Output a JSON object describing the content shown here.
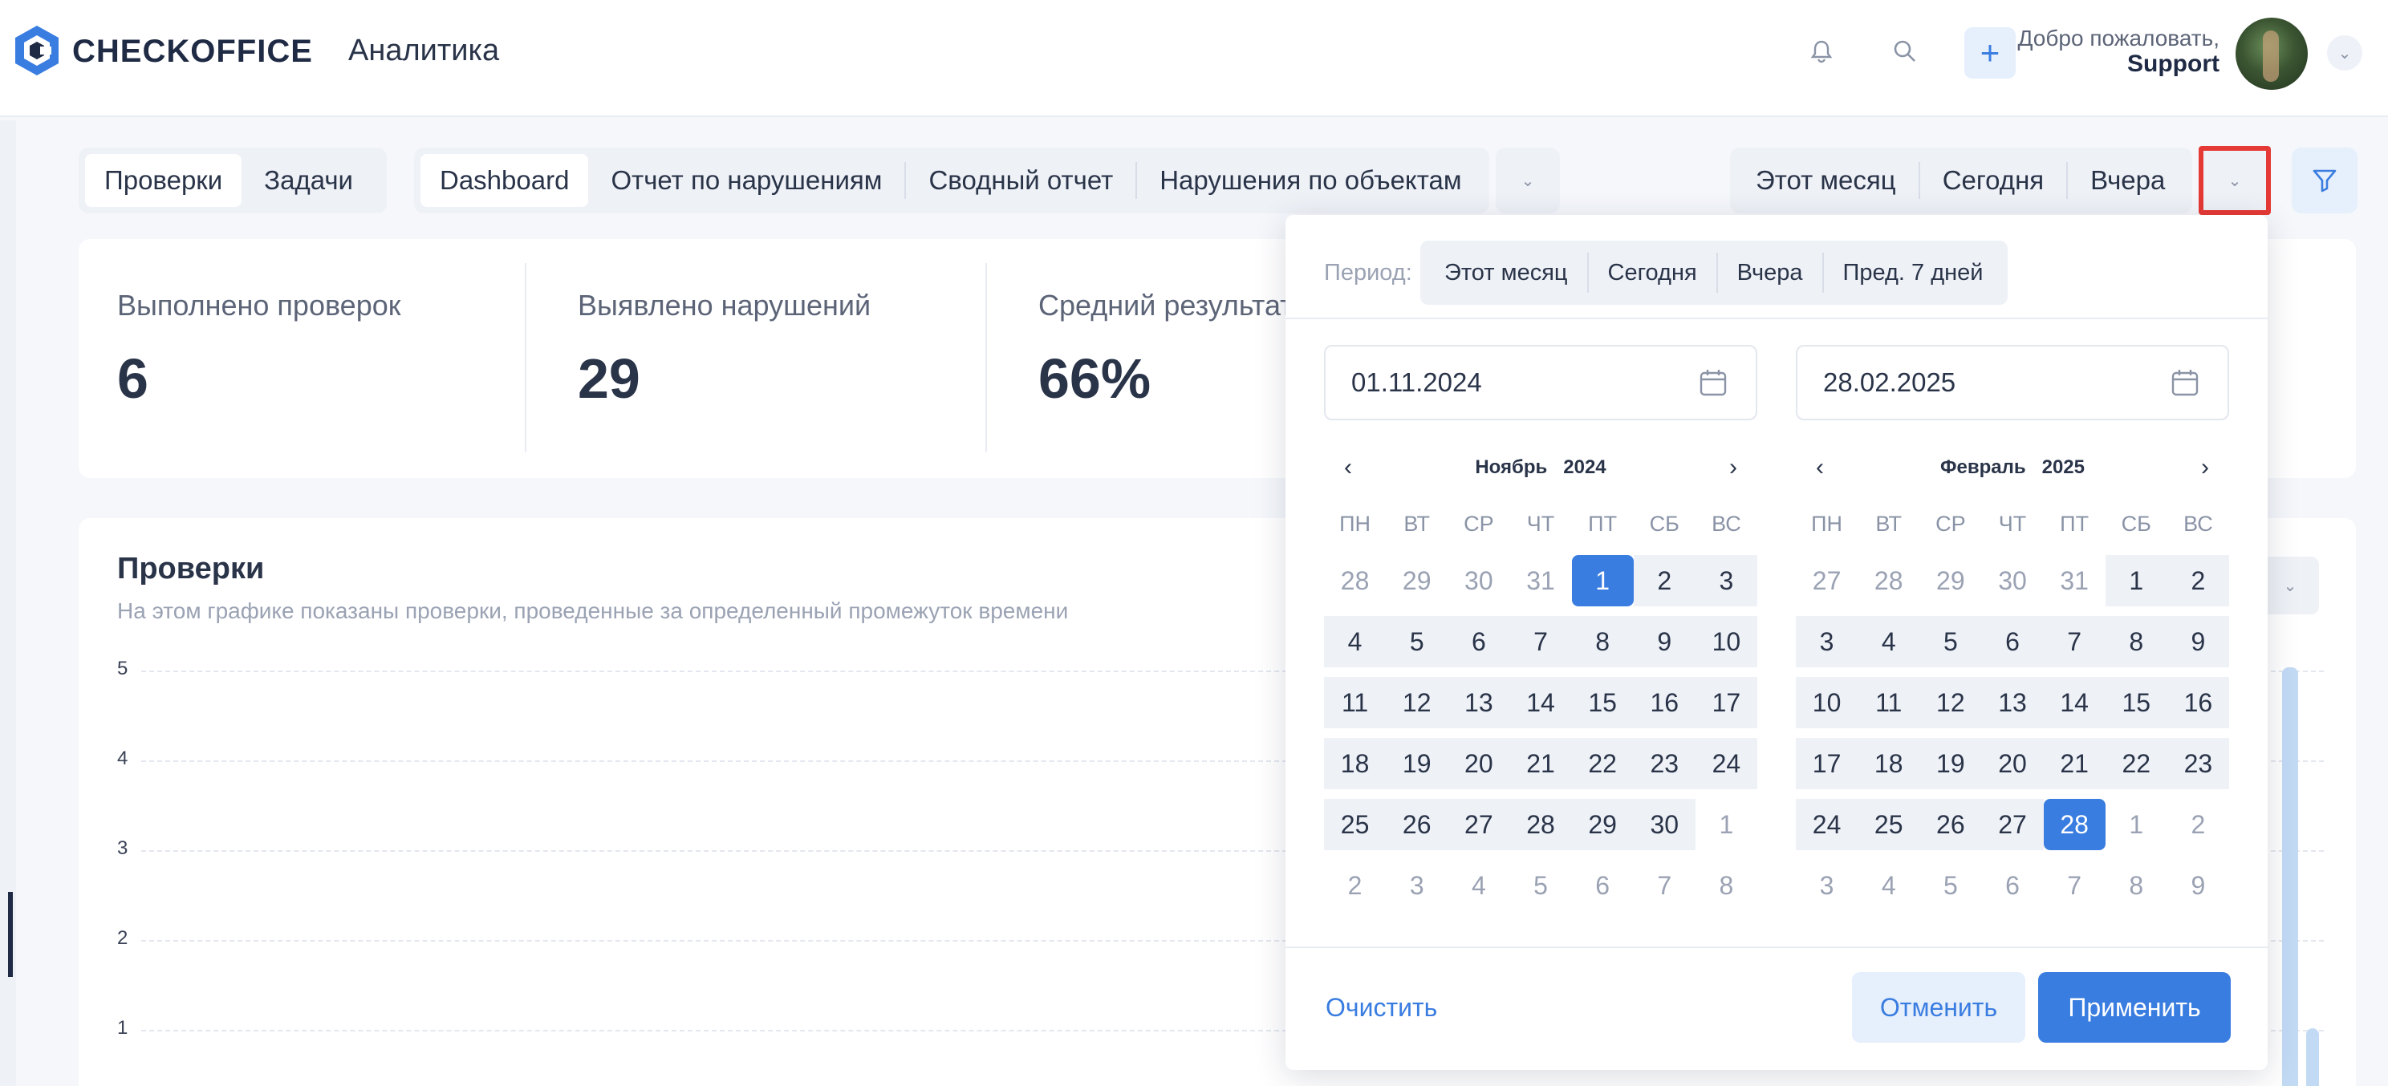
{
  "header": {
    "brand": "CHECKOFFICE",
    "page_title": "Аналитика",
    "icons": [
      "bell-icon",
      "search-icon",
      "plus-icon"
    ],
    "welcome": "Добро пожаловать,",
    "user": "Support"
  },
  "tabs_main": [
    "Проверки",
    "Задачи"
  ],
  "tabs_reports": [
    "Dashboard",
    "Отчет по нарушениям",
    "Сводный отчет",
    "Нарушения по объектам"
  ],
  "period_quick": [
    "Этот месяц",
    "Сегодня",
    "Вчера"
  ],
  "stats": [
    {
      "label": "Выполнено проверок",
      "value": "6"
    },
    {
      "label": "Выявлено нарушений",
      "value": "29"
    },
    {
      "label": "Средний результат",
      "value": "66%"
    }
  ],
  "chart": {
    "title": "Проверки",
    "subtitle": "На этом графике показаны проверки, проведенные за определенный промежуток времени"
  },
  "chart_data": {
    "type": "bar",
    "title": "Проверки",
    "y_ticks": [
      "5",
      "4",
      "3",
      "2",
      "1"
    ],
    "ylim": [
      0,
      5
    ],
    "grid": true
  },
  "popup": {
    "period_label": "Период:",
    "period_options": [
      "Этот месяц",
      "Сегодня",
      "Вчера",
      "Пред. 7 дней"
    ],
    "start_date": "01.11.2024",
    "end_date": "28.02.2025",
    "weekdays": [
      "ПН",
      "ВТ",
      "СР",
      "ЧТ",
      "ПТ",
      "СБ",
      "ВС"
    ],
    "left_month": {
      "month": "Ноябрь",
      "year": "2024",
      "prev": "‹",
      "next": "›",
      "days": [
        [
          "28",
          "out"
        ],
        [
          "29",
          "out"
        ],
        [
          "30",
          "out"
        ],
        [
          "31",
          "out"
        ],
        [
          "1",
          "sel"
        ],
        [
          "2",
          "in"
        ],
        [
          "3",
          "in"
        ],
        [
          "4",
          "in"
        ],
        [
          "5",
          "in"
        ],
        [
          "6",
          "in"
        ],
        [
          "7",
          "in"
        ],
        [
          "8",
          "in"
        ],
        [
          "9",
          "in"
        ],
        [
          "10",
          "in"
        ],
        [
          "11",
          "in"
        ],
        [
          "12",
          "in"
        ],
        [
          "13",
          "in"
        ],
        [
          "14",
          "in"
        ],
        [
          "15",
          "in"
        ],
        [
          "16",
          "in"
        ],
        [
          "17",
          "in"
        ],
        [
          "18",
          "in"
        ],
        [
          "19",
          "in"
        ],
        [
          "20",
          "in"
        ],
        [
          "21",
          "in"
        ],
        [
          "22",
          "in"
        ],
        [
          "23",
          "in"
        ],
        [
          "24",
          "in"
        ],
        [
          "25",
          "in"
        ],
        [
          "26",
          "in"
        ],
        [
          "27",
          "in"
        ],
        [
          "28",
          "in"
        ],
        [
          "29",
          "in"
        ],
        [
          "30",
          "in"
        ],
        [
          "1",
          "out"
        ],
        [
          "2",
          "out"
        ],
        [
          "3",
          "out"
        ],
        [
          "4",
          "out"
        ],
        [
          "5",
          "out"
        ],
        [
          "6",
          "out"
        ],
        [
          "7",
          "out"
        ],
        [
          "8",
          "out"
        ]
      ]
    },
    "right_month": {
      "month": "Февраль",
      "year": "2025",
      "prev": "‹",
      "next": "›",
      "days": [
        [
          "27",
          "out"
        ],
        [
          "28",
          "out"
        ],
        [
          "29",
          "out"
        ],
        [
          "30",
          "out"
        ],
        [
          "31",
          "out"
        ],
        [
          "1",
          "in"
        ],
        [
          "2",
          "in"
        ],
        [
          "3",
          "in"
        ],
        [
          "4",
          "in"
        ],
        [
          "5",
          "in"
        ],
        [
          "6",
          "in"
        ],
        [
          "7",
          "in"
        ],
        [
          "8",
          "in"
        ],
        [
          "9",
          "in"
        ],
        [
          "10",
          "in"
        ],
        [
          "11",
          "in"
        ],
        [
          "12",
          "in"
        ],
        [
          "13",
          "in"
        ],
        [
          "14",
          "in"
        ],
        [
          "15",
          "in"
        ],
        [
          "16",
          "in"
        ],
        [
          "17",
          "in"
        ],
        [
          "18",
          "in"
        ],
        [
          "19",
          "in"
        ],
        [
          "20",
          "in"
        ],
        [
          "21",
          "in"
        ],
        [
          "22",
          "in"
        ],
        [
          "23",
          "in"
        ],
        [
          "24",
          "in"
        ],
        [
          "25",
          "in"
        ],
        [
          "26",
          "in"
        ],
        [
          "27",
          "in"
        ],
        [
          "28",
          "sel"
        ],
        [
          "1",
          "out"
        ],
        [
          "2",
          "out"
        ],
        [
          "3",
          "out"
        ],
        [
          "4",
          "out"
        ],
        [
          "5",
          "out"
        ],
        [
          "6",
          "out"
        ],
        [
          "7",
          "out"
        ],
        [
          "8",
          "out"
        ],
        [
          "9",
          "out"
        ]
      ]
    },
    "clear": "Очистить",
    "cancel": "Отменить",
    "apply": "Применить"
  },
  "colors": {
    "accent": "#3a7de0",
    "highlight": "#e53935"
  }
}
